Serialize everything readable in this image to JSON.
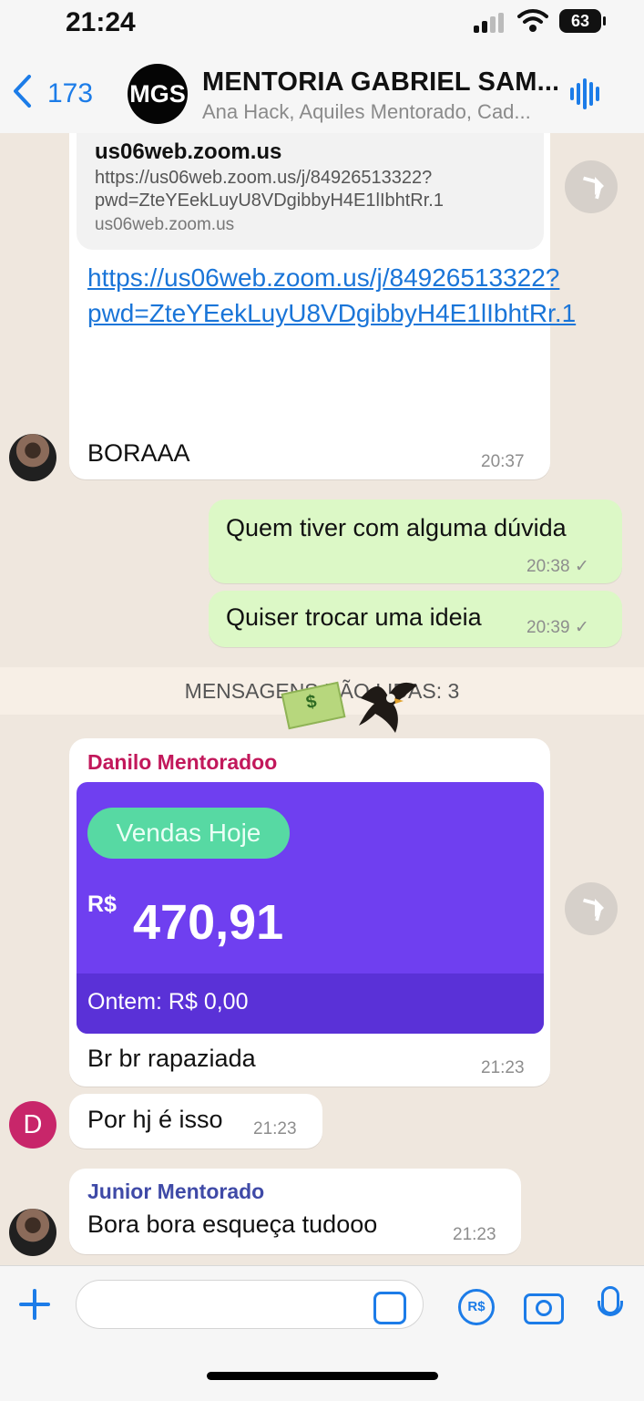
{
  "status": {
    "time": "21:24",
    "battery": "63"
  },
  "header": {
    "back_count": "173",
    "avatar": "MGS",
    "title": "MENTORIA GABRIEL SAM...",
    "subtitle": "Ana Hack, Aquiles Mentorado, Cad..."
  },
  "messages": {
    "preview": {
      "domain": "us06web.zoom.us",
      "url": "https://us06web.zoom.us/j/84926513322?pwd=ZteYEekLuyU8VDgibbyH4E1lIbhtRr.1",
      "host": "us06web.zoom.us"
    },
    "link": "https://us06web.zoom.us/j/84926513322?pwd=ZteYEekLuyU8VDgibbyH4E1lIbhtRr.1",
    "boraaa": "BORAAA",
    "boraaa_time": "20:37",
    "out1": "Quem tiver com alguma dúvida",
    "out1_time": "20:38 ✓",
    "out2": "Quiser trocar uma ideia",
    "out2_time": "20:39 ✓",
    "unread": "MENSAGENS NÃO LIDAS: 3",
    "danilo": {
      "name": "Danilo Mentoradoo",
      "pill": "Vendas Hoje",
      "currency": "R$",
      "amount": "470,91",
      "yesterday": "Ontem: R$ 0,00",
      "caption": "Br br rapaziada",
      "time": "21:23"
    },
    "d_initial": "D",
    "d_message": "Por hj é isso",
    "d_time": "21:23",
    "junior": {
      "name": "Junior Mentorado",
      "text": "Bora bora esqueça tudooo",
      "time": "21:23"
    }
  },
  "composer": {
    "rs_label": "R$"
  },
  "colors": {
    "accent": "#1c7ce8",
    "outgoing": "#dcf8c6",
    "card": "#6f3ff0",
    "pill": "#57d9a3"
  }
}
